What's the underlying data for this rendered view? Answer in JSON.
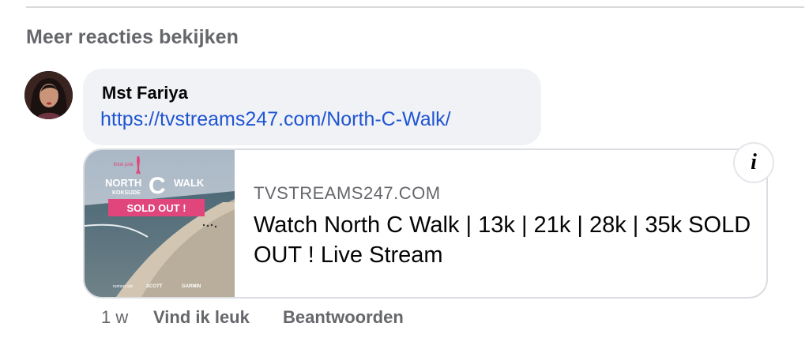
{
  "comments": {
    "more_label": "Meer reacties bekijken"
  },
  "comment": {
    "author": "Mst Fariya",
    "link_text": "https://tvstreams247.com/North-C-Walk/",
    "time": "1 w",
    "like_label": "Vind ik leuk",
    "reply_label": "Beantwoorden"
  },
  "preview": {
    "domain": "TVSTREAMS247.COM",
    "title": "Watch North C Walk | 13k | 21k | 28k | 35k SOLD OUT ! Live Stream",
    "info_icon": "info-icon",
    "thumb": {
      "brand_top": "think pink",
      "logo_north": "NORTH",
      "logo_c": "C",
      "logo_walk": "WALK",
      "logo_sub": "KOKSIJDE",
      "badge": "SOLD OUT !",
      "sponsor1": "runners lab",
      "sponsor2": "SCOTT",
      "sponsor3": "GARMIN"
    }
  },
  "colors": {
    "link": "#2055d3",
    "secondary_text": "#65676b",
    "bubble_bg": "#f0f2f5",
    "badge_pink": "#e0457b"
  }
}
